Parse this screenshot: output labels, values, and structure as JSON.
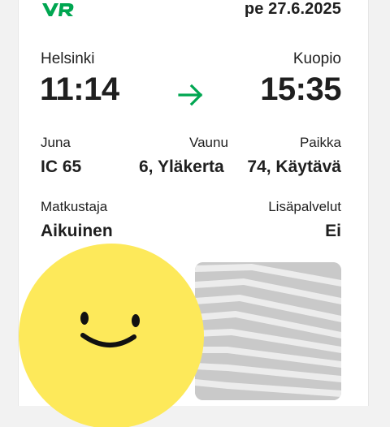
{
  "ticket": {
    "logo_text": "VR",
    "date": "pe 27.6.2025",
    "from_city": "Helsinki",
    "to_city": "Kuopio",
    "departure_time": "11:14",
    "arrival_time": "15:35",
    "train_label": "Juna",
    "train_value": "IC 65",
    "car_label": "Vaunu",
    "car_value": "6, Yläkerta",
    "seat_label": "Paikka",
    "seat_value": "74, Käytävä",
    "passenger_label": "Matkustaja",
    "passenger_value": "Aikuinen",
    "extras_label": "Lisäpalvelut",
    "extras_value": "Ei"
  },
  "icons": {
    "logo": "vr-logo-icon",
    "arrow": "arrow-right-icon",
    "sticker": "smiley-face-icon"
  },
  "colors": {
    "brand_green": "#00a651",
    "sticker_yellow": "#fde95a",
    "text": "#1f1f1f"
  }
}
